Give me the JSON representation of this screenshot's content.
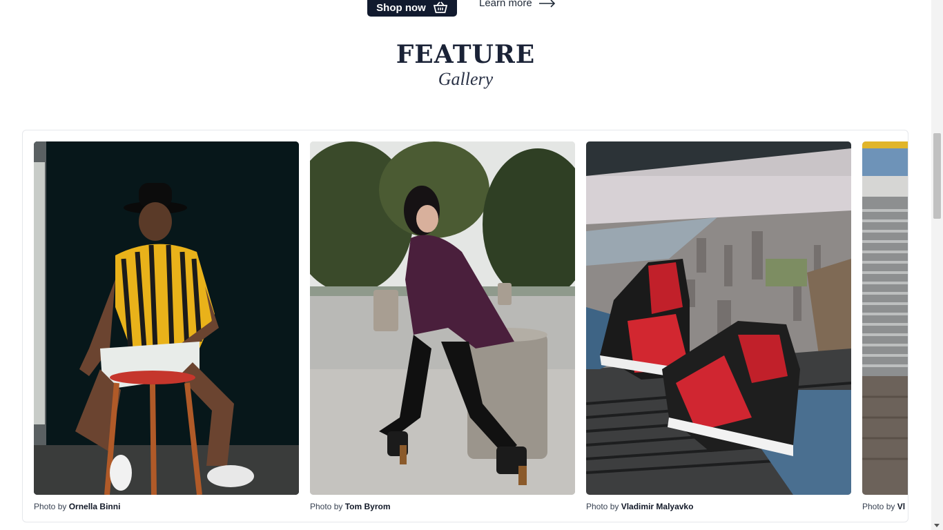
{
  "cta": {
    "shop_label": "Shop now",
    "learn_label": "Learn more"
  },
  "section": {
    "title": "FEATURE",
    "subtitle": "Gallery"
  },
  "gallery": {
    "credit_prefix": "Photo by",
    "photos": [
      {
        "author": "Ornella Binni"
      },
      {
        "author": "Tom Byrom"
      },
      {
        "author": "Vladimir Malyavko"
      },
      {
        "author": "Vl"
      }
    ]
  },
  "colors": {
    "button_bg": "#111a2e",
    "title": "#1a2236"
  }
}
